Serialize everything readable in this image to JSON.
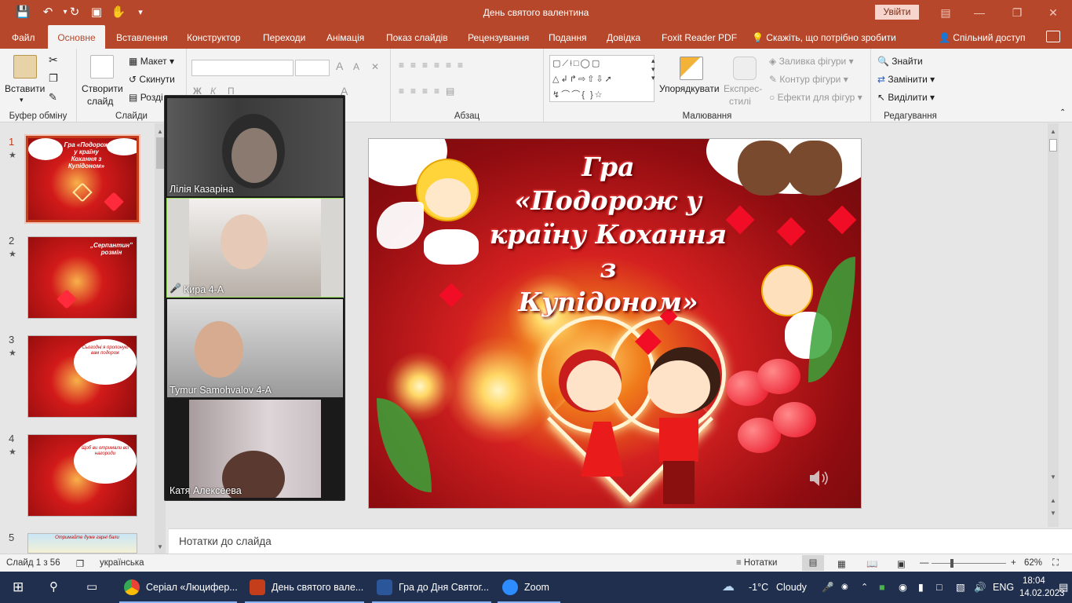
{
  "window": {
    "title": "День святого валентина",
    "signin_label": "Увійти"
  },
  "tabs": [
    {
      "label": "Файл"
    },
    {
      "label": "Основне"
    },
    {
      "label": "Вставлення"
    },
    {
      "label": "Конструктор"
    },
    {
      "label": "Переходи"
    },
    {
      "label": "Анімація"
    },
    {
      "label": "Показ слайдів"
    },
    {
      "label": "Рецензування"
    },
    {
      "label": "Подання"
    },
    {
      "label": "Довідка"
    },
    {
      "label": "Foxit Reader PDF"
    }
  ],
  "tell_me": "Скажіть, що потрібно зробити",
  "share": "Спільний доступ",
  "ribbon": {
    "clipboard": {
      "paste": "Вставити",
      "label": "Буфер обміну"
    },
    "slides": {
      "new_slide": "Створити",
      "new_slide_2": "слайд",
      "layout": "Макет",
      "reset": "Скинути",
      "section": "Розді",
      "label": "Слайди"
    },
    "paragraph": {
      "label": "Абзац"
    },
    "drawing": {
      "arrange": "Упорядкувати",
      "quick_styles": "Експрес-",
      "quick_styles_2": "стилі",
      "fill": "Заливка фігури",
      "outline": "Контур фігури",
      "effects": "Ефекти для фігур",
      "label": "Малювання"
    },
    "editing": {
      "find": "Знайти",
      "replace": "Замінити",
      "select": "Виділити",
      "label": "Редагування"
    }
  },
  "slides": [
    {
      "number": "1",
      "title": "Гра «Подорож у країну Кохання з Купідоном»"
    },
    {
      "number": "2",
      "title": "„Серпантин” розмін"
    },
    {
      "number": "3",
      "title": "Сьогодні я пропоную вам подорож"
    },
    {
      "number": "4",
      "title": "Щоб ви отримали всі нагороди"
    },
    {
      "number": "5",
      "title": "Отримайте дуже гарні бали"
    }
  ],
  "main_slide": {
    "title_line1": "Гра",
    "title_line2": "«Подорож у",
    "title_line3": "країну Кохання з",
    "title_line4": "Купідоном»"
  },
  "zoom_participants": [
    {
      "name": "Лілія Казаріна"
    },
    {
      "name": "Кира 4-А",
      "muted": true
    },
    {
      "name": "Tymur Samohvalov 4-A"
    },
    {
      "name": "Катя Алексеева"
    }
  ],
  "notes_placeholder": "Нотатки до слайда",
  "status": {
    "slide_count": "Слайд 1 з 56",
    "language": "українська",
    "notes_button": "Нотатки",
    "zoom_level": "62%"
  },
  "taskbar": {
    "apps": [
      {
        "label": "Серіал «Люцифер..."
      },
      {
        "label": "День святого вале..."
      },
      {
        "label": "Гра до Дня Святог..."
      },
      {
        "label": "Zoom"
      }
    ],
    "weather_temp": "-1°C",
    "weather_text": "Cloudy",
    "lang": "ENG",
    "time": "18:04",
    "date": "14.02.2023"
  },
  "colors": {
    "accent": "#b7472a",
    "active_slide_border": "#c43e1c",
    "taskbar": "#1f2f4d"
  }
}
